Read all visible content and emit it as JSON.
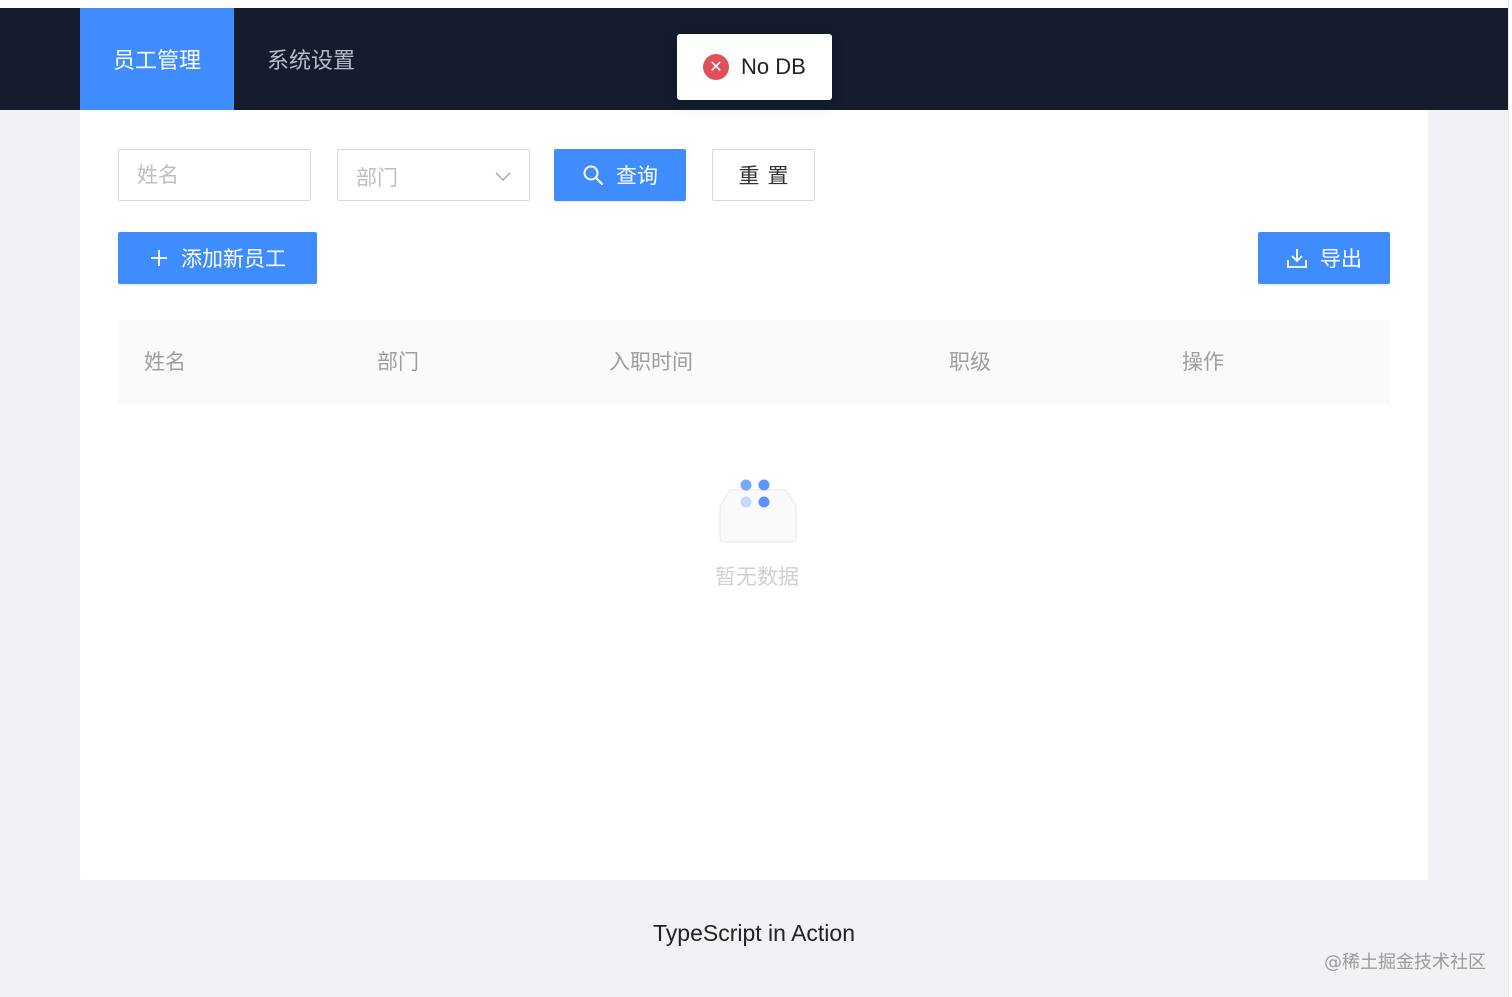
{
  "nav": {
    "items": [
      {
        "label": "员工管理",
        "active": true
      },
      {
        "label": "系统设置",
        "active": false
      }
    ]
  },
  "toast": {
    "type": "error",
    "icon": "error-circle-icon",
    "message": "No DB"
  },
  "filters": {
    "name_placeholder": "姓名",
    "dept_placeholder": "部门",
    "search_label": "查询",
    "reset_label": "重置"
  },
  "actions": {
    "add_label": "添加新员工",
    "export_label": "导出"
  },
  "table": {
    "columns": [
      "姓名",
      "部门",
      "入职时间",
      "职级",
      "操作"
    ],
    "rows": [],
    "empty_text": "暂无数据"
  },
  "footer": {
    "text": "TypeScript in Action"
  },
  "watermark": "@稀土掘金技术社区",
  "colors": {
    "header_bg": "#141c2e",
    "primary": "#3f8cff",
    "error": "#e0505a"
  }
}
